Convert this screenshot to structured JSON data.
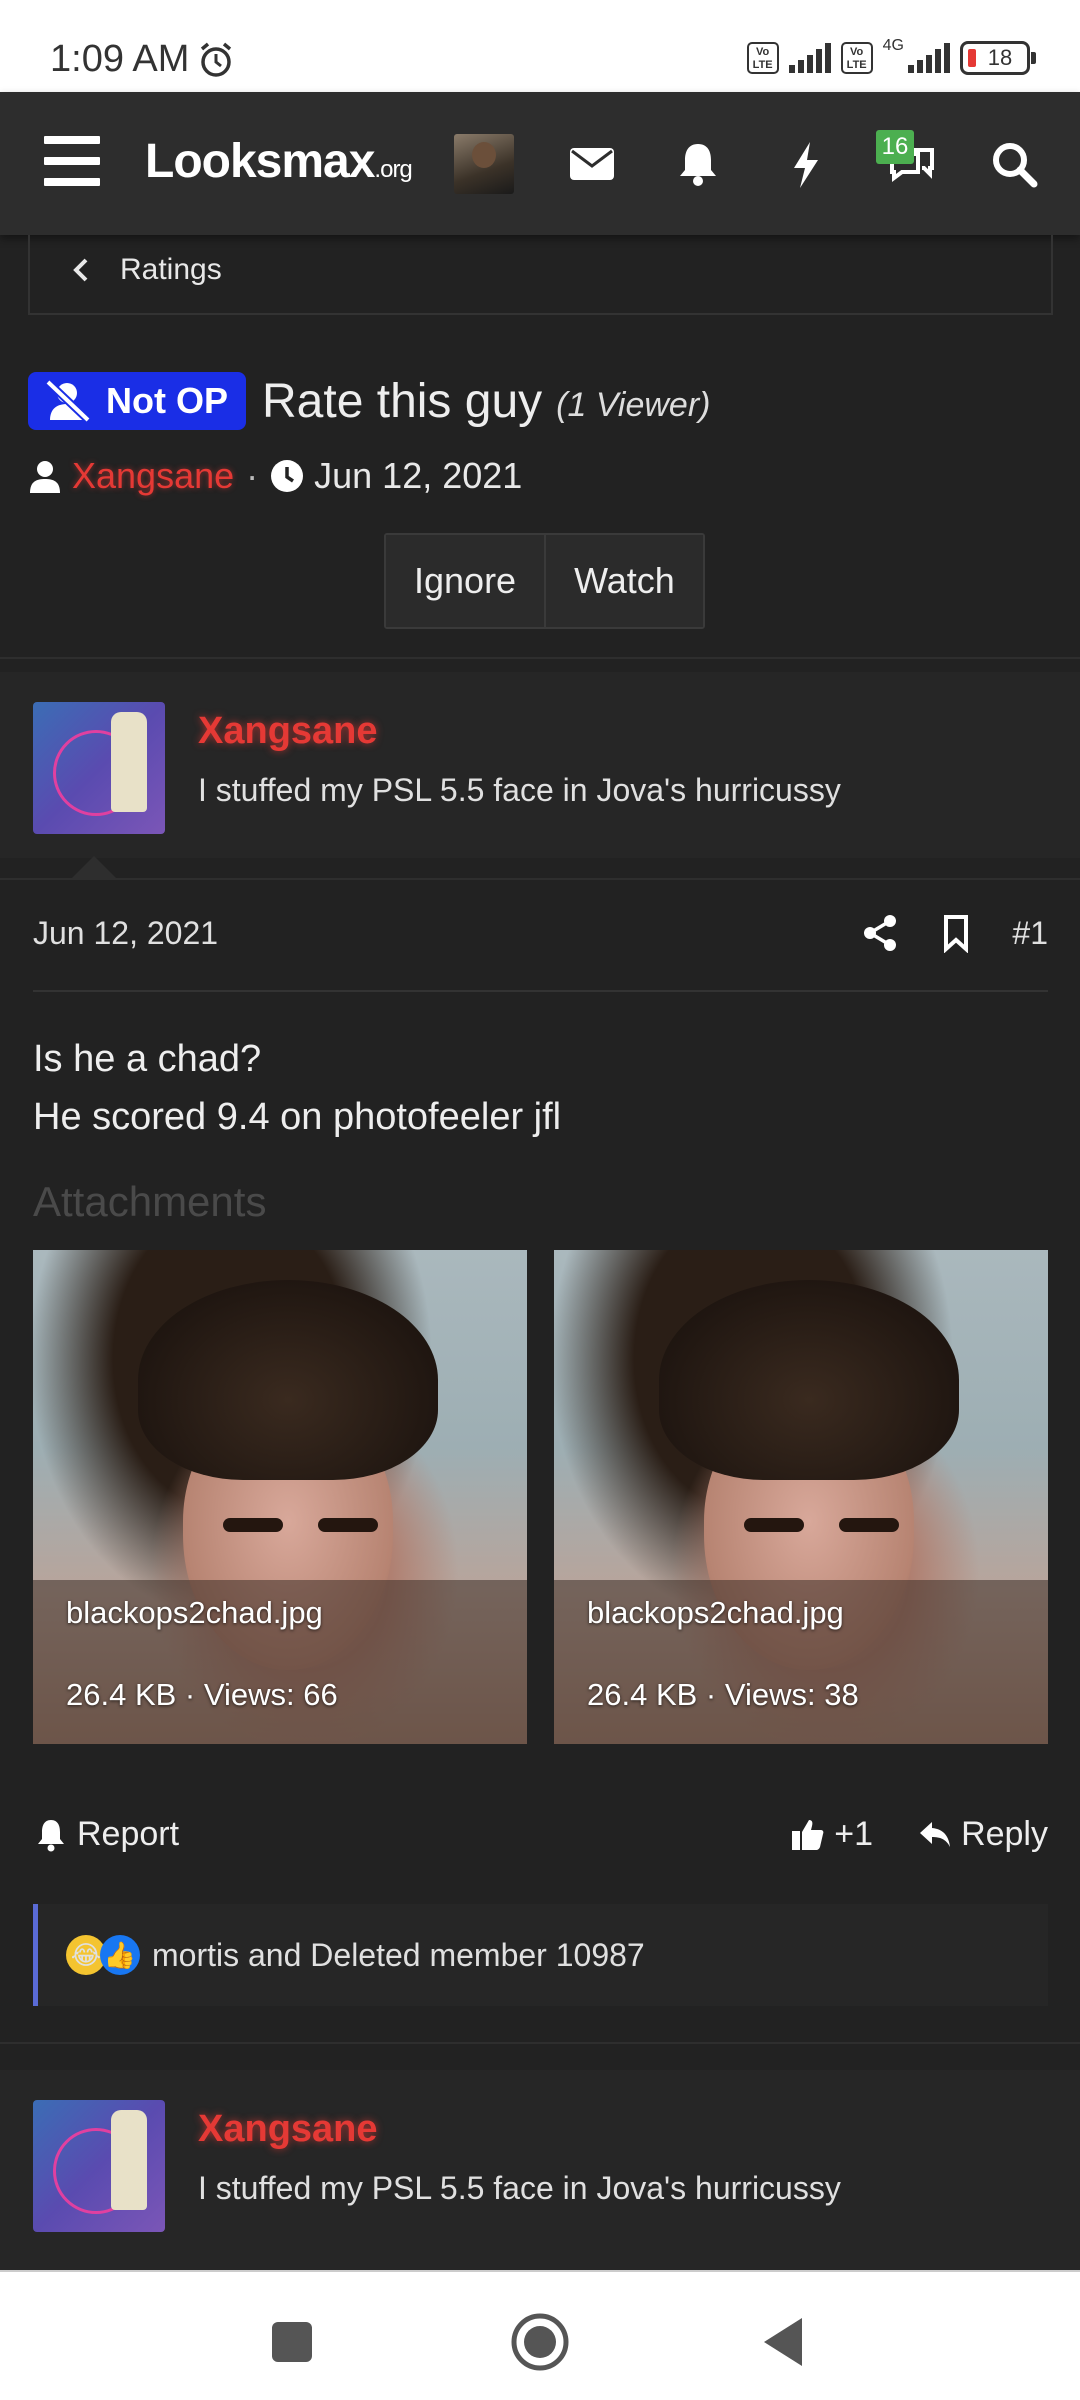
{
  "status_bar": {
    "time": "1:09 AM",
    "net_label": "4G",
    "volte_label": "Vo LTE",
    "battery": "18",
    "icons": [
      "alarm-icon",
      "volte-icon",
      "signal-icon",
      "battery-icon"
    ]
  },
  "header": {
    "logo_main": "Looksmax",
    "logo_suffix": ".org",
    "notification_badge": "16",
    "icons": [
      "menu-icon",
      "mail-icon",
      "bell-icon",
      "bolt-icon",
      "chat-icon",
      "search-icon"
    ]
  },
  "breadcrumb": {
    "label": "Ratings"
  },
  "thread": {
    "prefix": "Not OP",
    "title": "Rate this guy",
    "viewers": "(1 Viewer)",
    "author": "Xangsane",
    "date": "Jun 12, 2021",
    "buttons": {
      "ignore": "Ignore",
      "watch": "Watch"
    }
  },
  "posts": [
    {
      "username": "Xangsane",
      "user_title": "I stuffed my PSL 5.5 face in Jova's hurricussy",
      "date": "Jun 12, 2021",
      "number": "#1",
      "body_line1": "Is he a chad?",
      "body_line2": "He scored 9.4 on photofeeler jfl",
      "attachments_title": "Attachments",
      "attachments": [
        {
          "name": "blackops2chad.jpg",
          "meta": "26.4 KB · Views: 66"
        },
        {
          "name": "blackops2chad.jpg",
          "meta": "26.4 KB · Views: 38"
        }
      ],
      "report_label": "Report",
      "like_label": "+1",
      "reply_label": "Reply",
      "reactions_text": "mortis and Deleted member 10987"
    },
    {
      "username": "Xangsane",
      "user_title": "I stuffed my PSL 5.5 face in Jova's hurricussy"
    }
  ],
  "colors": {
    "background": "#222222",
    "header_bg": "#2d2d2d",
    "username_red": "#e53935",
    "not_op_blue": "#1a2ee6",
    "badge_green": "#4caf50",
    "reaction_border": "#5a6bd6"
  }
}
